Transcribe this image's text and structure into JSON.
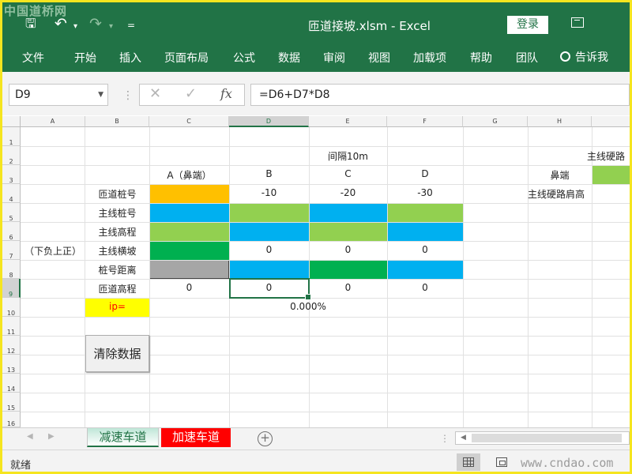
{
  "watermark_top": "中国道桥网",
  "watermark_bottom": "www.cndao.com",
  "title": "匝道接坡.xlsm  -  Excel",
  "login": "登录",
  "quick_access": {
    "save": "🖫",
    "undo": "↶",
    "redo": "↷",
    "more": "▾",
    "customize": "="
  },
  "ribbon_tabs": [
    "文件",
    "开始",
    "插入",
    "页面布局",
    "公式",
    "数据",
    "审阅",
    "视图",
    "加载项",
    "帮助",
    "团队"
  ],
  "tell_me": "告诉我",
  "name_box": "D9",
  "formula": "=D6+D7*D8",
  "fx_symbols": {
    "cancel": "✕",
    "enter": "✓",
    "fx": "fx"
  },
  "columns": [
    "A",
    "B",
    "C",
    "D",
    "E",
    "F",
    "G",
    "H"
  ],
  "rows": [
    "1",
    "2",
    "3",
    "4",
    "5",
    "6",
    "7",
    "8",
    "9",
    "10",
    "11",
    "12",
    "13",
    "14",
    "15",
    "16"
  ],
  "cells": {
    "D2": "间隔10m",
    "C3": "A（鼻端）",
    "D3": "B",
    "E3": "C",
    "F3": "D",
    "H3": "鼻端",
    "I2": "主线硬路",
    "B4": "匝道桩号",
    "D4": "-10",
    "E4": "-20",
    "F4": "-30",
    "H4": "主线硬路肩高",
    "B5": "主线桩号",
    "B6": "主线高程",
    "A7": "（下负上正）",
    "B7": "主线横坡",
    "D7": "0",
    "E7": "0",
    "F7": "0",
    "B8": "桩号距离",
    "B9": "匝道高程",
    "C9": "0",
    "D9": "0",
    "E9": "0",
    "F9": "0",
    "B10": "ip=",
    "D10": "0.000%"
  },
  "colors": {
    "orange": "#ffc000",
    "blue": "#00b0f0",
    "lightgreen": "#92d050",
    "green": "#00b050",
    "gray": "#a6a6a6",
    "yellow": "#ffff00",
    "excel_green": "#217346"
  },
  "clear_button": "清除数据",
  "sheet_tabs": [
    "减速车道",
    "加速车道"
  ],
  "add_sheet": "+",
  "status": "就绪"
}
